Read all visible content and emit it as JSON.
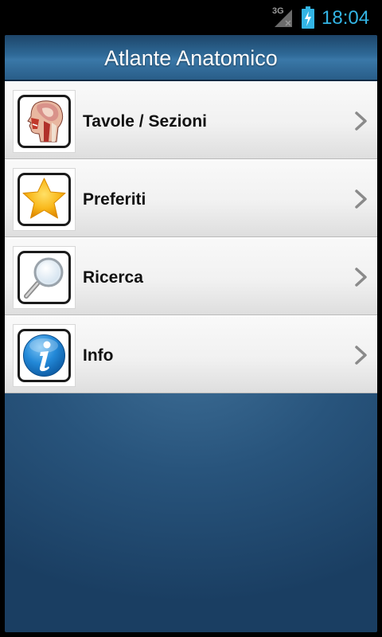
{
  "status_bar": {
    "network": "3G",
    "time": "18:04",
    "accent_color": "#33b5e5"
  },
  "header": {
    "title": "Atlante Anatomico"
  },
  "menu": {
    "items": [
      {
        "label": "Tavole / Sezioni",
        "icon": "head-anatomy-icon"
      },
      {
        "label": "Preferiti",
        "icon": "star-icon"
      },
      {
        "label": "Ricerca",
        "icon": "magnifier-icon"
      },
      {
        "label": "Info",
        "icon": "info-icon"
      }
    ]
  },
  "colors": {
    "title_bar": "#2f6a98",
    "background": "#28547c",
    "list_item": "#f1f1f1"
  }
}
